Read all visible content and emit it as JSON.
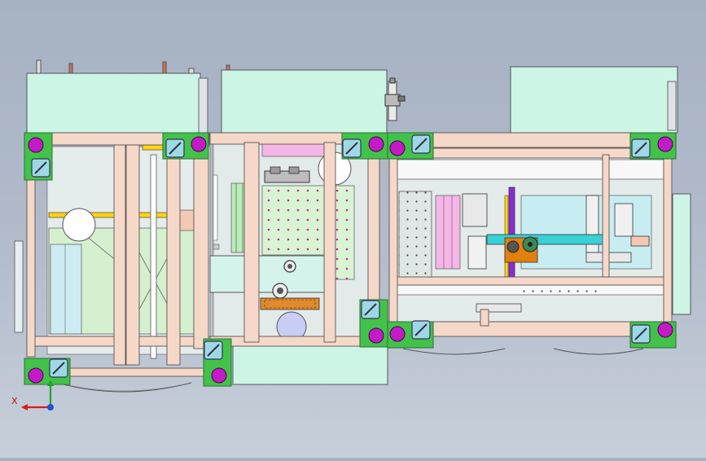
{
  "viewport": {
    "background_top": "#a6b1c2",
    "background_bottom": "#c7cfda"
  },
  "colors": {
    "frame_beam": "#f6d8c8",
    "frame_stroke": "#555555",
    "box_fill": "#ccf5e6",
    "panel_green": "#d7f2cf",
    "panel_blue": "#c8ecf5",
    "pink": "#f2a7dc",
    "magenta_foot": "#c51ac8",
    "corner_plate": "#42c24a",
    "caster": "#9ed8e6",
    "cyan_bar": "#37d1d6",
    "yellow_rail": "#ffd40a",
    "motor_orange": "#e2800e",
    "purple": "#8a2bd9"
  },
  "modules": [
    "left-module",
    "middle-module",
    "right-module"
  ],
  "axis_triad": {
    "x_label": "X",
    "x_color": "#e01919",
    "y_color": "#1aa62b",
    "z_color": "#1f4fd6"
  }
}
